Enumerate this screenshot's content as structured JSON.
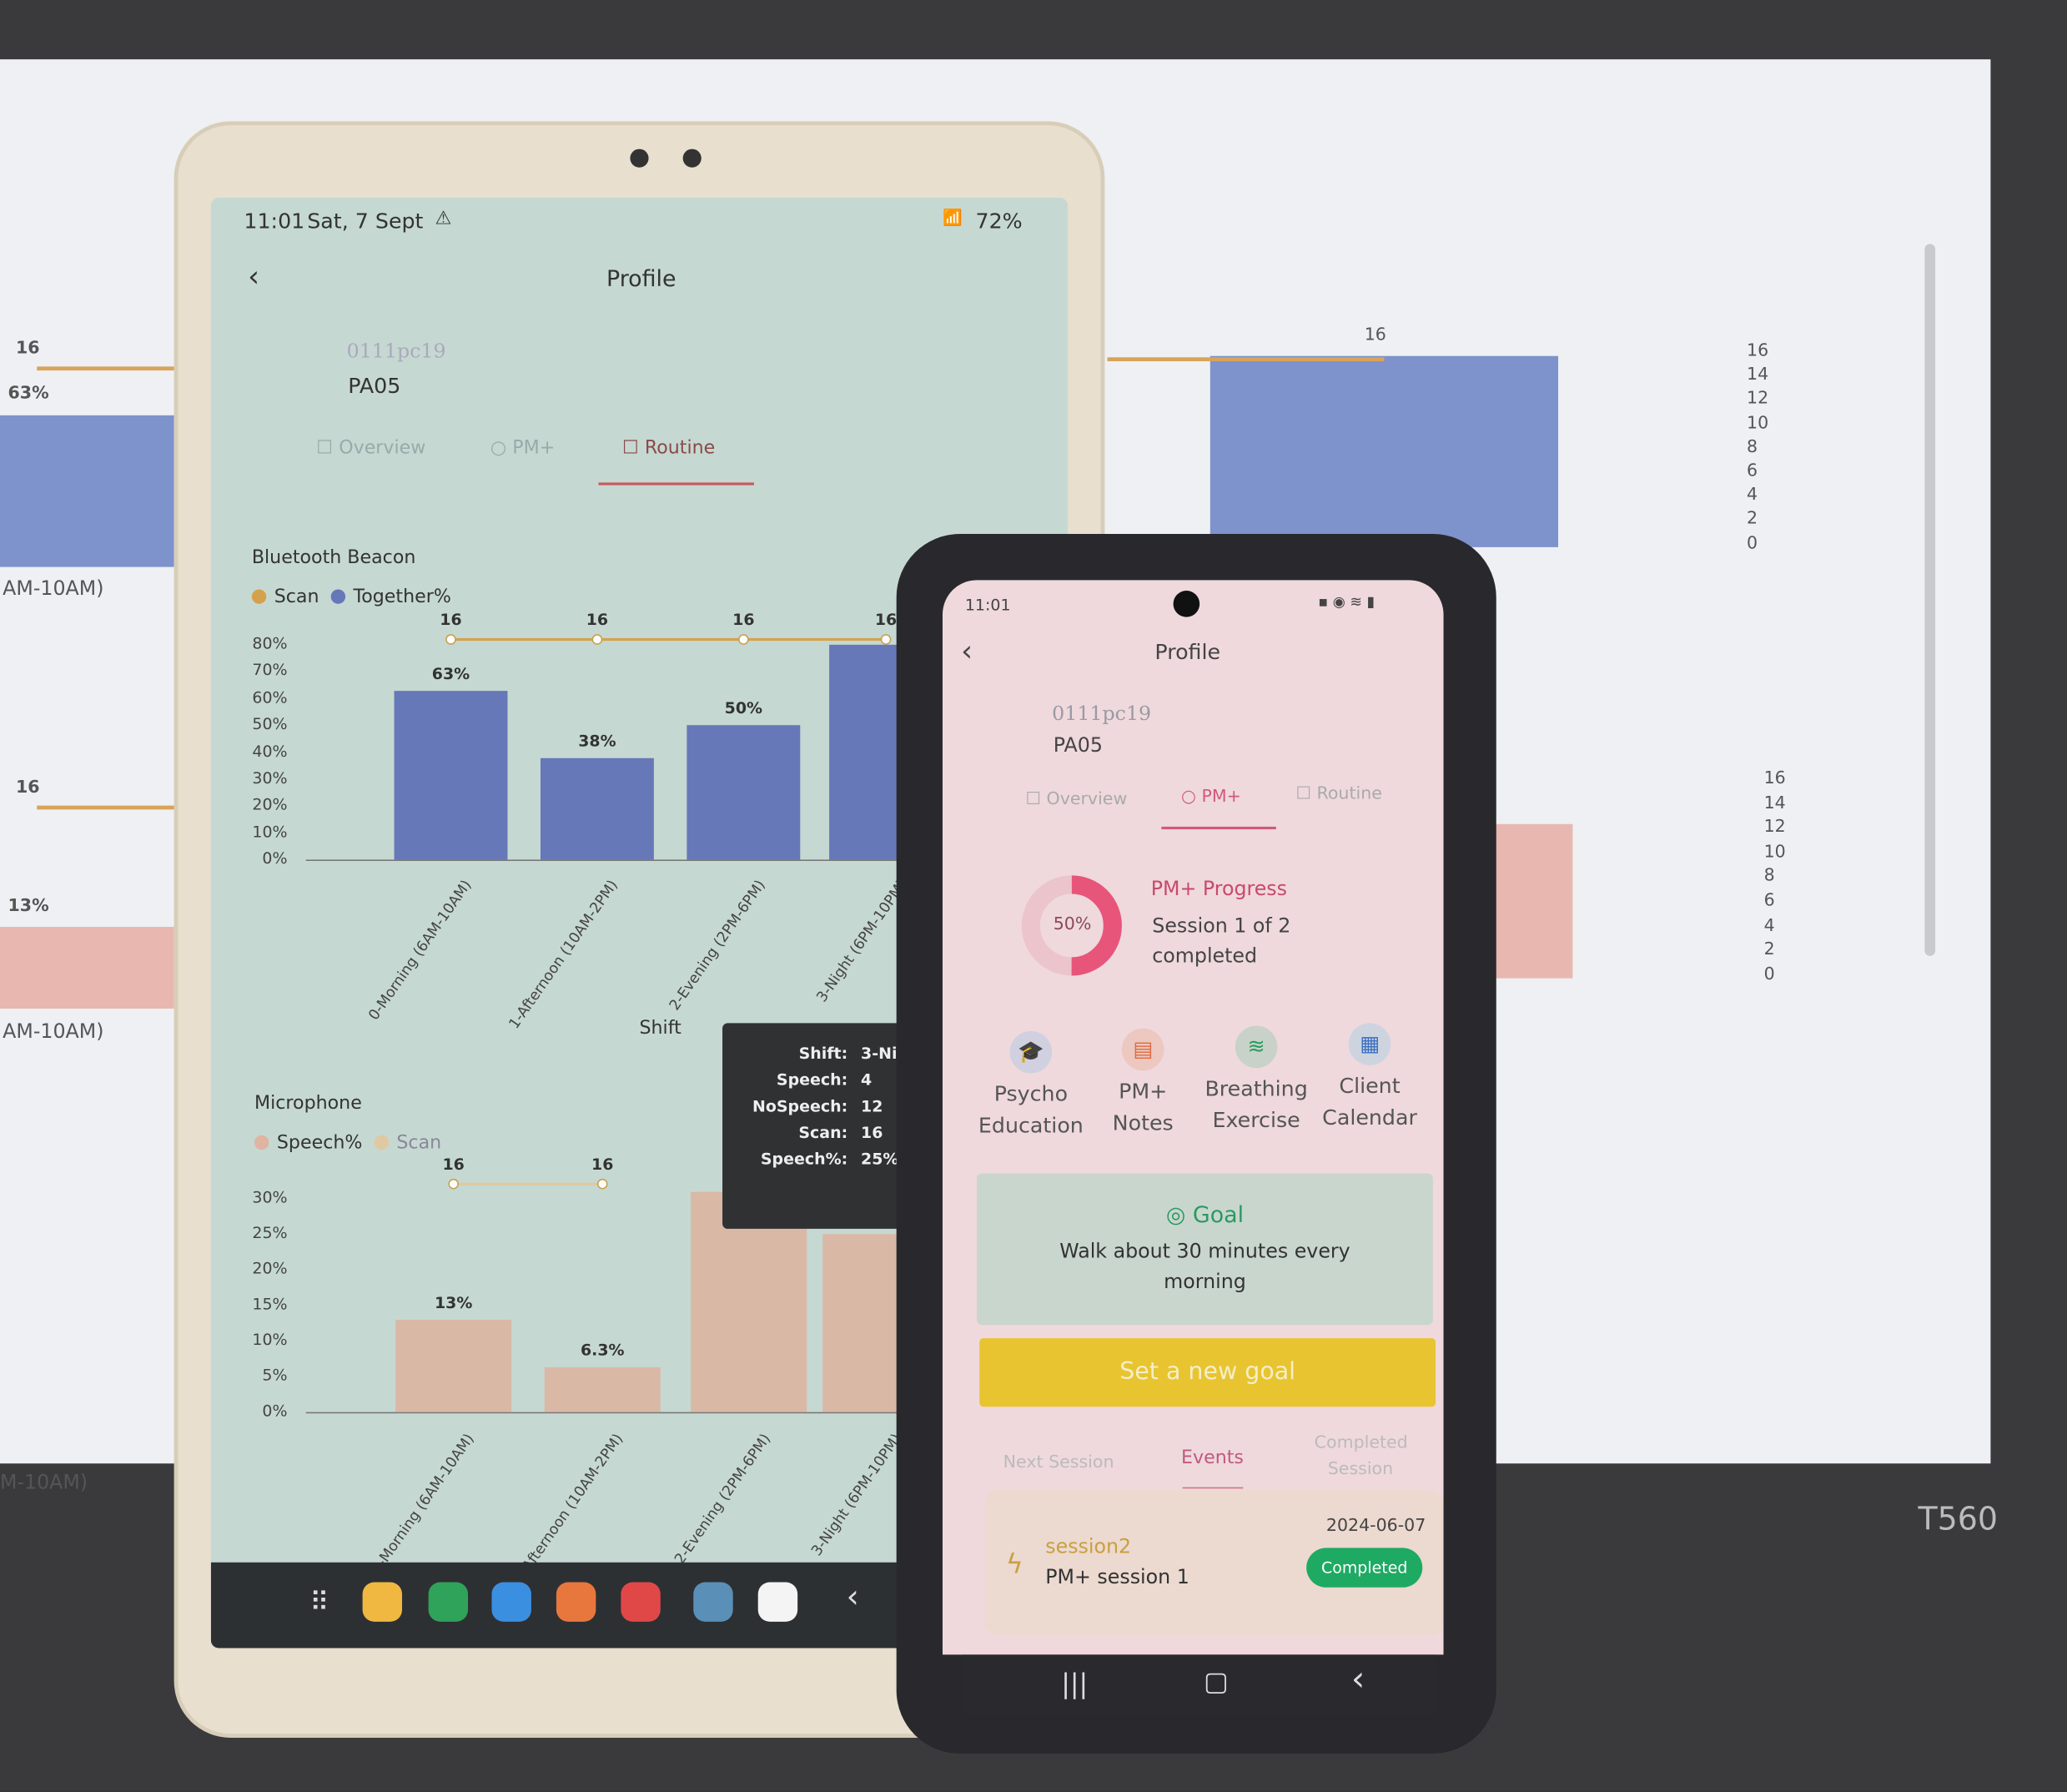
{
  "laptop": {
    "model_label": "T560",
    "right_chart_1": {
      "scan_label": "16",
      "axis_ticks": [
        "16",
        "14",
        "12",
        "10",
        "8",
        "6",
        "4",
        "2",
        "0"
      ],
      "bar_color": "#7e92cc"
    },
    "right_chart_2": {
      "axis_ticks": [
        "16",
        "14",
        "12",
        "10",
        "8",
        "6",
        "4",
        "2",
        "0"
      ],
      "bar_color": "#e8b8b0"
    },
    "left_chart_1": {
      "scan_label": "16",
      "value_label": "63%",
      "category_fragment": "AM-10AM)"
    },
    "left_chart_2": {
      "scan_label": "16",
      "value_label": "13%",
      "category_fragment": "AM-10AM)"
    },
    "left_chart_3": {
      "category_fragment": "M-10AM)"
    }
  },
  "tablet": {
    "status": {
      "time": "11:01",
      "date": "Sat, 7 Sept",
      "battery": "72%"
    },
    "header": {
      "title": "Profile"
    },
    "profile": {
      "id": "0111pc19",
      "name": "PA05"
    },
    "tabs": [
      {
        "label": "Overview"
      },
      {
        "label": "PM+"
      },
      {
        "label": "Routine",
        "active": true
      }
    ],
    "tooltip": {
      "rows": [
        {
          "k": "Shift:",
          "v": "3-Nigh"
        },
        {
          "k": "Speech:",
          "v": "4"
        },
        {
          "k": "NoSpeech:",
          "v": "12"
        },
        {
          "k": "Scan:",
          "v": "16"
        },
        {
          "k": "Speech%:",
          "v": "25%"
        }
      ]
    }
  },
  "chart_data": [
    {
      "type": "bar",
      "title": "Bluetooth Beacon",
      "xlabel": "Shift",
      "categories": [
        "0-Morning (6AM-10AM)",
        "1-Afternoon (10AM-2PM)",
        "2-Evening (2PM-6PM)",
        "3-Night (6PM-10PM)"
      ],
      "y_ticks": [
        "80%",
        "70%",
        "60%",
        "50%",
        "40%",
        "30%",
        "20%",
        "10%",
        "0%"
      ],
      "ylim": [
        0,
        80
      ],
      "series": [
        {
          "name": "Together%",
          "kind": "bar",
          "values": [
            63,
            38,
            50,
            80
          ],
          "labels": [
            "63%",
            "38%",
            "50%",
            ""
          ],
          "color": "#6678b8"
        },
        {
          "name": "Scan",
          "kind": "line",
          "values": [
            16,
            16,
            16,
            16
          ],
          "labels": [
            "16",
            "16",
            "16",
            "16"
          ],
          "color": "#d4a24c"
        }
      ],
      "legend": "top-left"
    },
    {
      "type": "bar",
      "title": "Microphone",
      "categories": [
        "0-Morning (6AM-10AM)",
        "1-Afternoon (10AM-2PM)",
        "2-Evening (2PM-6PM)",
        "3-Night (6PM-10PM)"
      ],
      "y_ticks": [
        "30%",
        "25%",
        "20%",
        "15%",
        "10%",
        "5%",
        "0%"
      ],
      "ylim": [
        0,
        30
      ],
      "series": [
        {
          "name": "Speech%",
          "kind": "bar",
          "values": [
            13,
            6.3,
            31,
            25
          ],
          "labels": [
            "13%",
            "6.3%",
            "",
            ""
          ],
          "color": "#d9b8a6"
        },
        {
          "name": "Scan",
          "kind": "line",
          "values": [
            16,
            16
          ],
          "labels": [
            "16",
            "16"
          ],
          "color": "#e0c9a0"
        }
      ],
      "legend": "top-left"
    }
  ],
  "phone": {
    "status": {
      "time": "11:01"
    },
    "header": {
      "title": "Profile"
    },
    "profile": {
      "id": "0111pc19",
      "name": "PA05"
    },
    "tabs": [
      {
        "label": "Overview"
      },
      {
        "label": "PM+",
        "active": true
      },
      {
        "label": "Routine"
      }
    ],
    "progress": {
      "title": "PM+ Progress",
      "percent": 50,
      "percent_label": "50%",
      "line1": "Session 1 of 2",
      "line2": "completed",
      "accent": "#e8557a"
    },
    "actions": [
      {
        "line1": "Psycho",
        "line2": "Education",
        "icon": "graduation-cap-icon"
      },
      {
        "line1": "PM+",
        "line2": "Notes",
        "icon": "note-icon"
      },
      {
        "line1": "Breathing",
        "line2": "Exercise",
        "icon": "wind-icon"
      },
      {
        "line1": "Client",
        "line2": "Calendar",
        "icon": "calendar-icon"
      }
    ],
    "goal": {
      "title": "Goal",
      "text": "Walk about 30 minutes every morning"
    },
    "set_goal_button": "Set a new goal",
    "session_tabs": [
      {
        "label": "Next Session"
      },
      {
        "label": "Events",
        "active": true
      },
      {
        "label": "Completed Session"
      }
    ],
    "event": {
      "title": "session2",
      "subtitle": "PM+ session 1",
      "date": "2024-06-07",
      "status": "Completed",
      "status_color": "#1faa63"
    }
  }
}
